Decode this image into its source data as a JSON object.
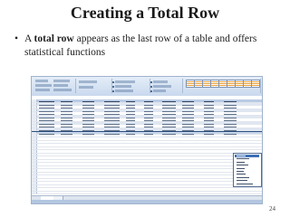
{
  "slide": {
    "title": "Creating a Total Row",
    "bullet_marker": "•",
    "bullet_pre": "A ",
    "bullet_bold": "total row",
    "bullet_post": " appears as the last row of a table and offers statistical functions",
    "page_number": "24"
  },
  "colors": {
    "title": "#1a1a1a",
    "ribbon": "#c9d9ee",
    "table_header": "#b9cbe4",
    "table_band": "#dfe7f2",
    "selected_menu_item": "#3c6fb5"
  },
  "screenshot": {
    "content": "embedded Excel window showing a table with a total row and an open function drop-down list",
    "icon": "excel-screenshot-icon"
  }
}
